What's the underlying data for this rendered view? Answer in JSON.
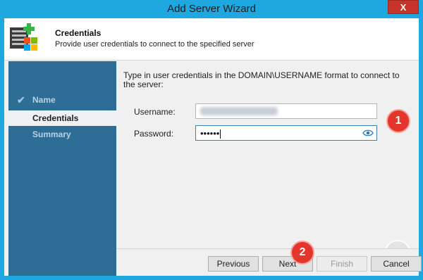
{
  "window": {
    "title": "Add Server Wizard",
    "close_glyph": "X"
  },
  "header": {
    "title": "Credentials",
    "subtitle": "Provide user credentials to connect to the specified server",
    "icon": "server-add-icon"
  },
  "steps": [
    {
      "label": "Name",
      "state": "completed"
    },
    {
      "label": "Credentials",
      "state": "active"
    },
    {
      "label": "Summary",
      "state": "pending"
    }
  ],
  "content": {
    "instruction": "Type in user credentials in the DOMAIN\\USERNAME format to connect to the server:",
    "username_label": "Username:",
    "username_value": "",
    "password_label": "Password:",
    "password_value": "••••••"
  },
  "annotations": {
    "badge1": "1",
    "badge2": "2"
  },
  "buttons": {
    "previous": "Previous",
    "next": "Next",
    "finish": "Finish",
    "cancel": "Cancel"
  },
  "watermark": "RDR",
  "colors": {
    "titlebar": "#1fa8e0",
    "close": "#c7342b",
    "sidebar": "#2e6d95",
    "badge": "#e4352c"
  }
}
